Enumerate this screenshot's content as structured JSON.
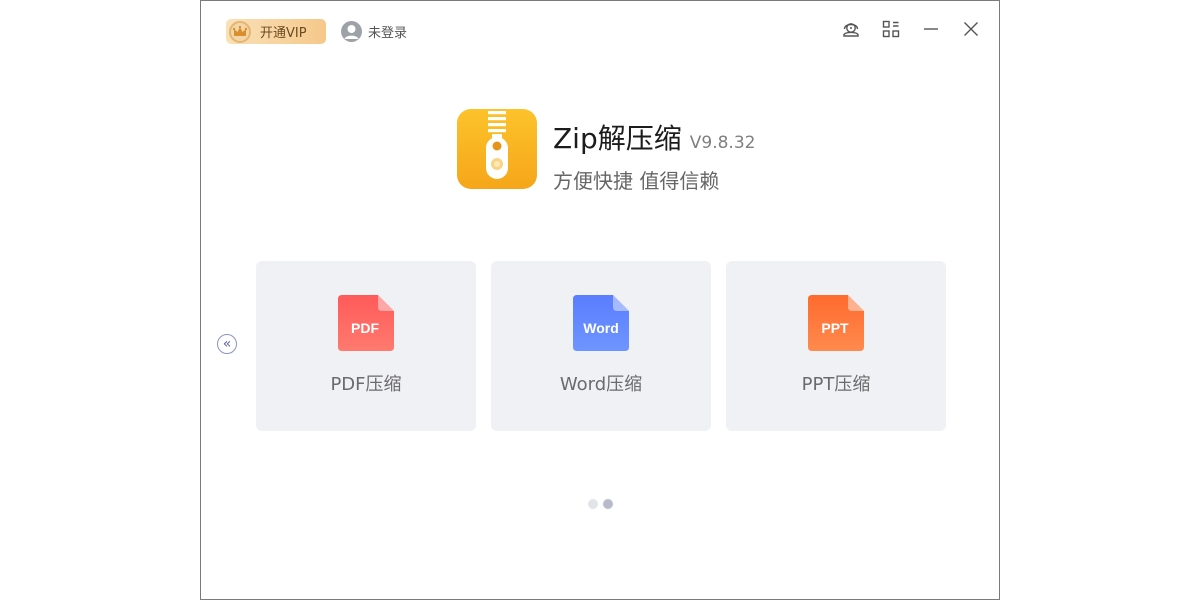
{
  "topbar": {
    "vip_label": "开通VIP",
    "login_label": "未登录"
  },
  "app": {
    "title": "Zip解压缩",
    "version": "V9.8.32",
    "slogan": "方便快捷 值得信赖"
  },
  "cards": [
    {
      "name": "pdf",
      "icon_text": "PDF",
      "label": "PDF压缩",
      "color_top": "#ff5a5a",
      "color_bottom": "#ff7a6e"
    },
    {
      "name": "word",
      "icon_text": "Word",
      "label": "Word压缩",
      "color_top": "#5a7dff",
      "color_bottom": "#6f95ff"
    },
    {
      "name": "ppt",
      "icon_text": "PPT",
      "label": "PPT压缩",
      "color_top": "#ff6a2e",
      "color_bottom": "#ff8a4d"
    }
  ],
  "pager": {
    "pages": 2,
    "current": 2
  },
  "colors": {
    "vip_gradient_start": "#f9e1b8",
    "vip_gradient_end": "#f6c88a",
    "logo_yellow": "#fbb829",
    "card_bg": "#f0f1f5"
  }
}
